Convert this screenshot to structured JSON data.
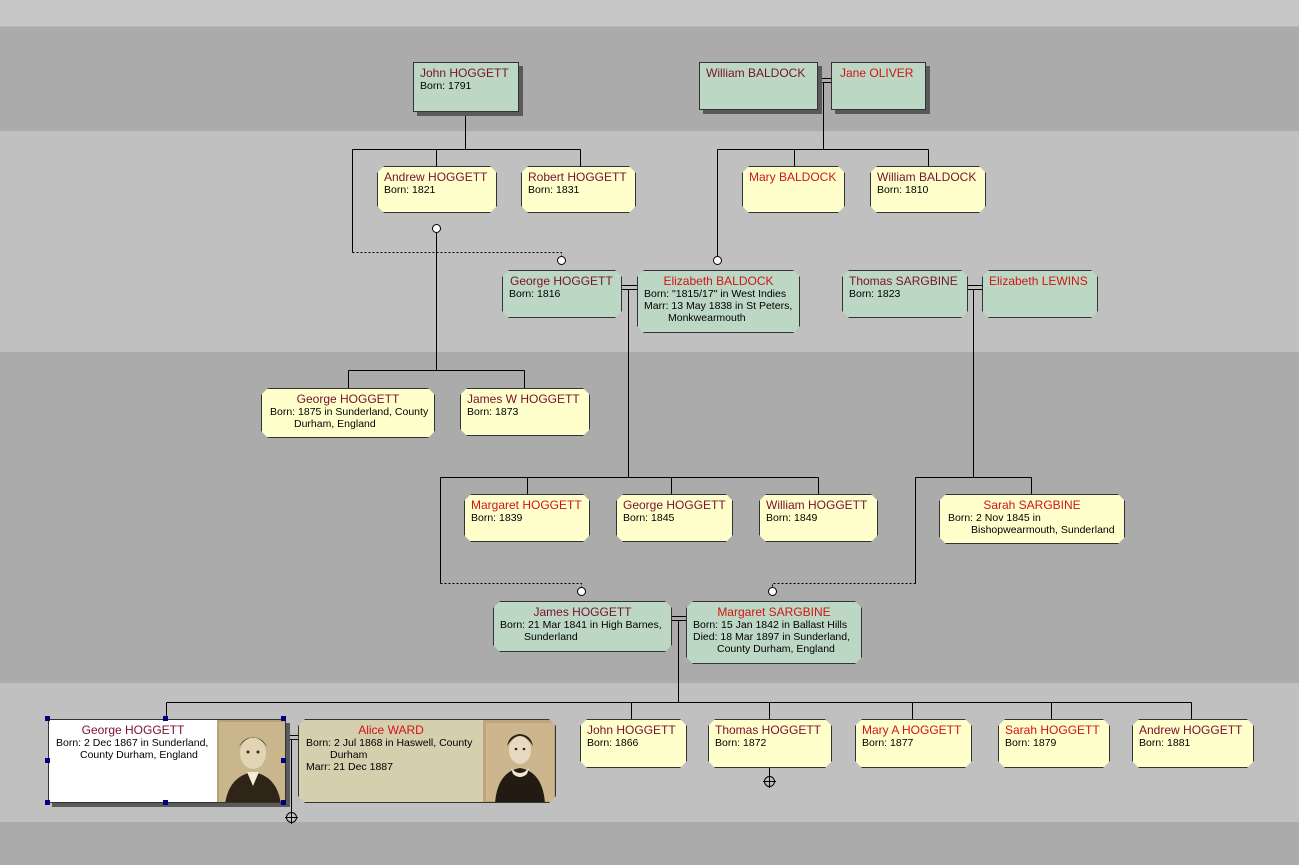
{
  "people": {
    "john_1791": {
      "name": "John HOGGETT",
      "l1": "Born: 1791"
    },
    "william_baldock_sr": {
      "name": "William BALDOCK"
    },
    "jane_oliver": {
      "name": "Jane OLIVER"
    },
    "andrew_1821": {
      "name": "Andrew HOGGETT",
      "l1": "Born: 1821"
    },
    "robert_1831": {
      "name": "Robert HOGGETT",
      "l1": "Born: 1831"
    },
    "mary_baldock": {
      "name": "Mary BALDOCK"
    },
    "william_baldock_1810": {
      "name": "William BALDOCK",
      "l1": "Born: 1810"
    },
    "george_1816": {
      "name": "George HOGGETT",
      "l1": "Born: 1816"
    },
    "elizabeth_baldock": {
      "name": "Elizabeth BALDOCK",
      "l1": "Born: \"1815/17\" in West Indies",
      "l2": "Marr: 13 May 1838 in St Peters,",
      "l3": "Monkwearmouth"
    },
    "thomas_sargbine": {
      "name": "Thomas SARGBINE",
      "l1": "Born: 1823"
    },
    "elizabeth_lewins": {
      "name": "Elizabeth LEWINS"
    },
    "george_1875": {
      "name": "George HOGGETT",
      "l1": "Born: 1875 in Sunderland, County",
      "l2": "Durham, England"
    },
    "james_w": {
      "name": "James W HOGGETT",
      "l1": "Born: 1873"
    },
    "margaret_1839": {
      "name": "Margaret HOGGETT",
      "l1": "Born: 1839"
    },
    "george_1845": {
      "name": "George HOGGETT",
      "l1": "Born: 1845"
    },
    "william_1849": {
      "name": "William HOGGETT",
      "l1": "Born: 1849"
    },
    "sarah_sargbine": {
      "name": "Sarah SARGBINE",
      "l1": "Born: 2 Nov 1845 in",
      "l2": "Bishopwearmouth, Sunderland"
    },
    "james_1841": {
      "name": "James HOGGETT",
      "l1": "Born: 21 Mar 1841 in High Barnes,",
      "l2": "Sunderland"
    },
    "margaret_sargbine": {
      "name": "Margaret SARGBINE",
      "l1": "Born: 15 Jan 1842 in Ballast Hills",
      "l2": "Died: 18 Mar 1897 in Sunderland,",
      "l3": "County Durham, England"
    },
    "george_1867": {
      "name": "George HOGGETT",
      "l1": "Born: 2 Dec 1867 in Sunderland,",
      "l2": "County Durham, England"
    },
    "alice_ward": {
      "name": "Alice WARD",
      "l1": "Born: 2 Jul 1868 in Haswell, County",
      "l2": "Durham",
      "l3": "Marr: 21 Dec 1887"
    },
    "john_1866": {
      "name": "John HOGGETT",
      "l1": "Born: 1866"
    },
    "thomas_1872": {
      "name": "Thomas HOGGETT",
      "l1": "Born: 1872"
    },
    "mary_a_1877": {
      "name": "Mary A HOGGETT",
      "l1": "Born: 1877"
    },
    "sarah_1879": {
      "name": "Sarah HOGGETT",
      "l1": "Born: 1879"
    },
    "andrew_1881": {
      "name": "Andrew HOGGETT",
      "l1": "Born: 1881"
    }
  },
  "colors": {
    "band_light": "#c0c0c0",
    "band_dark": "#ababab",
    "box_green": "#bcd8c4",
    "box_yellow": "#ffffcc",
    "box_tan": "#d6cfae",
    "male_name": "#7a1030",
    "female_name": "#d21414",
    "selection_handle": "#000080"
  }
}
